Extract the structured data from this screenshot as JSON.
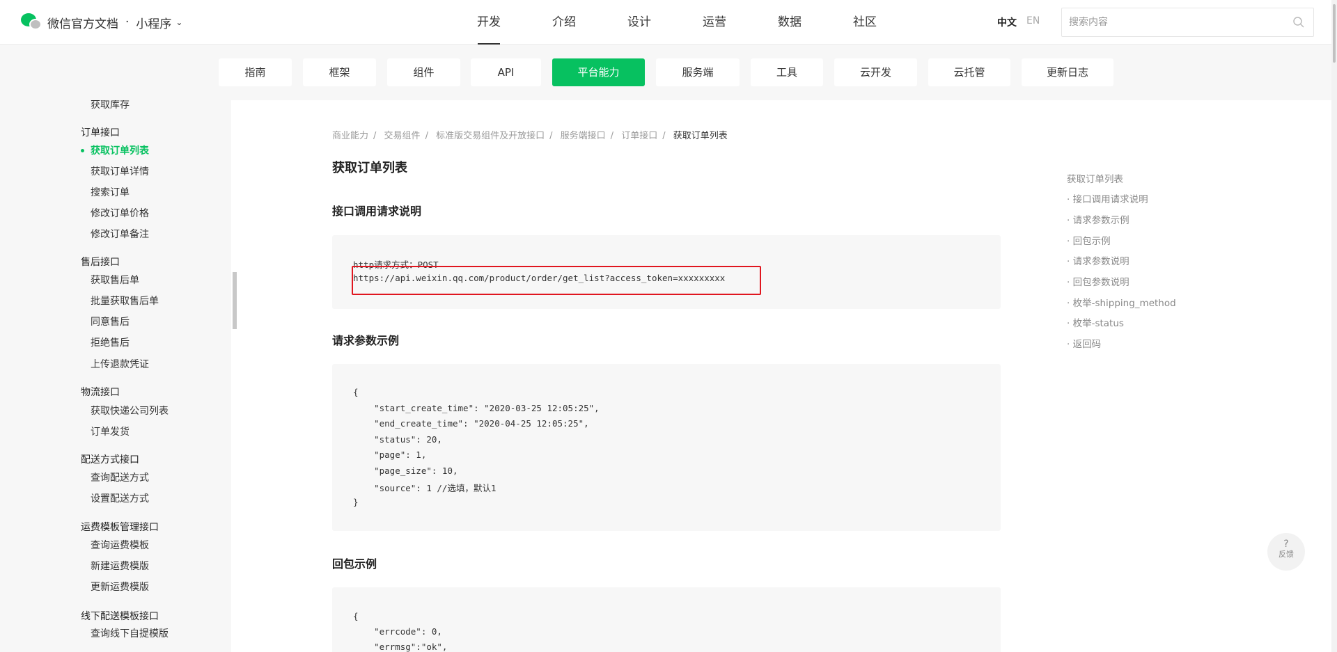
{
  "header": {
    "brand_title": "微信官方文档",
    "brand_dot": "·",
    "product": "小程序",
    "product_chevron_icon": "chevron-down-icon",
    "nav": [
      "开发",
      "介绍",
      "设计",
      "运营",
      "数据",
      "社区"
    ],
    "active_nav": "开发",
    "lang_zh": "中文",
    "lang_en": "EN",
    "search_placeholder": "搜索内容",
    "search_icon": "search-icon"
  },
  "subnav": {
    "tabs": [
      "指南",
      "框架",
      "组件",
      "API",
      "平台能力",
      "服务端",
      "工具",
      "云开发",
      "云托管",
      "更新日志"
    ],
    "active": "平台能力",
    "accent": "#07c160"
  },
  "sidebar": {
    "items": [
      {
        "label": "获取库存",
        "kind": "item"
      },
      {
        "label": "订单接口",
        "kind": "group"
      },
      {
        "label": "获取订单列表",
        "kind": "item",
        "active": true
      },
      {
        "label": "获取订单详情",
        "kind": "item"
      },
      {
        "label": "搜索订单",
        "kind": "item"
      },
      {
        "label": "修改订单价格",
        "kind": "item"
      },
      {
        "label": "修改订单备注",
        "kind": "item"
      },
      {
        "label": "售后接口",
        "kind": "group"
      },
      {
        "label": "获取售后单",
        "kind": "item"
      },
      {
        "label": "批量获取售后单",
        "kind": "item"
      },
      {
        "label": "同意售后",
        "kind": "item"
      },
      {
        "label": "拒绝售后",
        "kind": "item"
      },
      {
        "label": "上传退款凭证",
        "kind": "item"
      },
      {
        "label": "物流接口",
        "kind": "group"
      },
      {
        "label": "获取快递公司列表",
        "kind": "item"
      },
      {
        "label": "订单发货",
        "kind": "item"
      },
      {
        "label": "配送方式接口",
        "kind": "group"
      },
      {
        "label": "查询配送方式",
        "kind": "item"
      },
      {
        "label": "设置配送方式",
        "kind": "item"
      },
      {
        "label": "运费模板管理接口",
        "kind": "group"
      },
      {
        "label": "查询运费模板",
        "kind": "item"
      },
      {
        "label": "新建运费模版",
        "kind": "item"
      },
      {
        "label": "更新运费模版",
        "kind": "item"
      },
      {
        "label": "线下配送模板接口",
        "kind": "group"
      },
      {
        "label": "查询线下自提模版",
        "kind": "item"
      }
    ]
  },
  "breadcrumb": [
    "商业能力",
    "交易组件",
    "标准版交易组件及开放接口",
    "服务端接口",
    "订单接口",
    "获取订单列表"
  ],
  "page_title": "获取订单列表",
  "sections": {
    "request_desc": {
      "title": "接口调用请求说明",
      "lines": [
        "http请求方式：POST",
        "https://api.weixin.qq.com/product/order/get_list?access_token=xxxxxxxxx"
      ]
    },
    "request_example": {
      "title": "请求参数示例",
      "lines": [
        "{",
        "    \"start_create_time\": \"2020-03-25 12:05:25\",",
        "    \"end_create_time\": \"2020-04-25 12:05:25\",",
        "    \"status\": 20,",
        "    \"page\": 1,",
        "    \"page_size\": 10,",
        "    \"source\": 1 //选填，默认1",
        "}"
      ]
    },
    "response_example": {
      "title": "回包示例",
      "lines": [
        "{",
        "    \"errcode\": 0,",
        "    \"errmsg\":\"ok\","
      ]
    }
  },
  "toc": [
    "获取订单列表",
    "· 接口调用请求说明",
    "· 请求参数示例",
    "· 回包示例",
    "· 请求参数说明",
    "· 回包参数说明",
    "· 枚举-shipping_method",
    "· 枚举-status",
    "· 返回码"
  ],
  "feedback": {
    "icon": "question-icon",
    "label": "反馈"
  },
  "highlight_color": "#e0161f"
}
